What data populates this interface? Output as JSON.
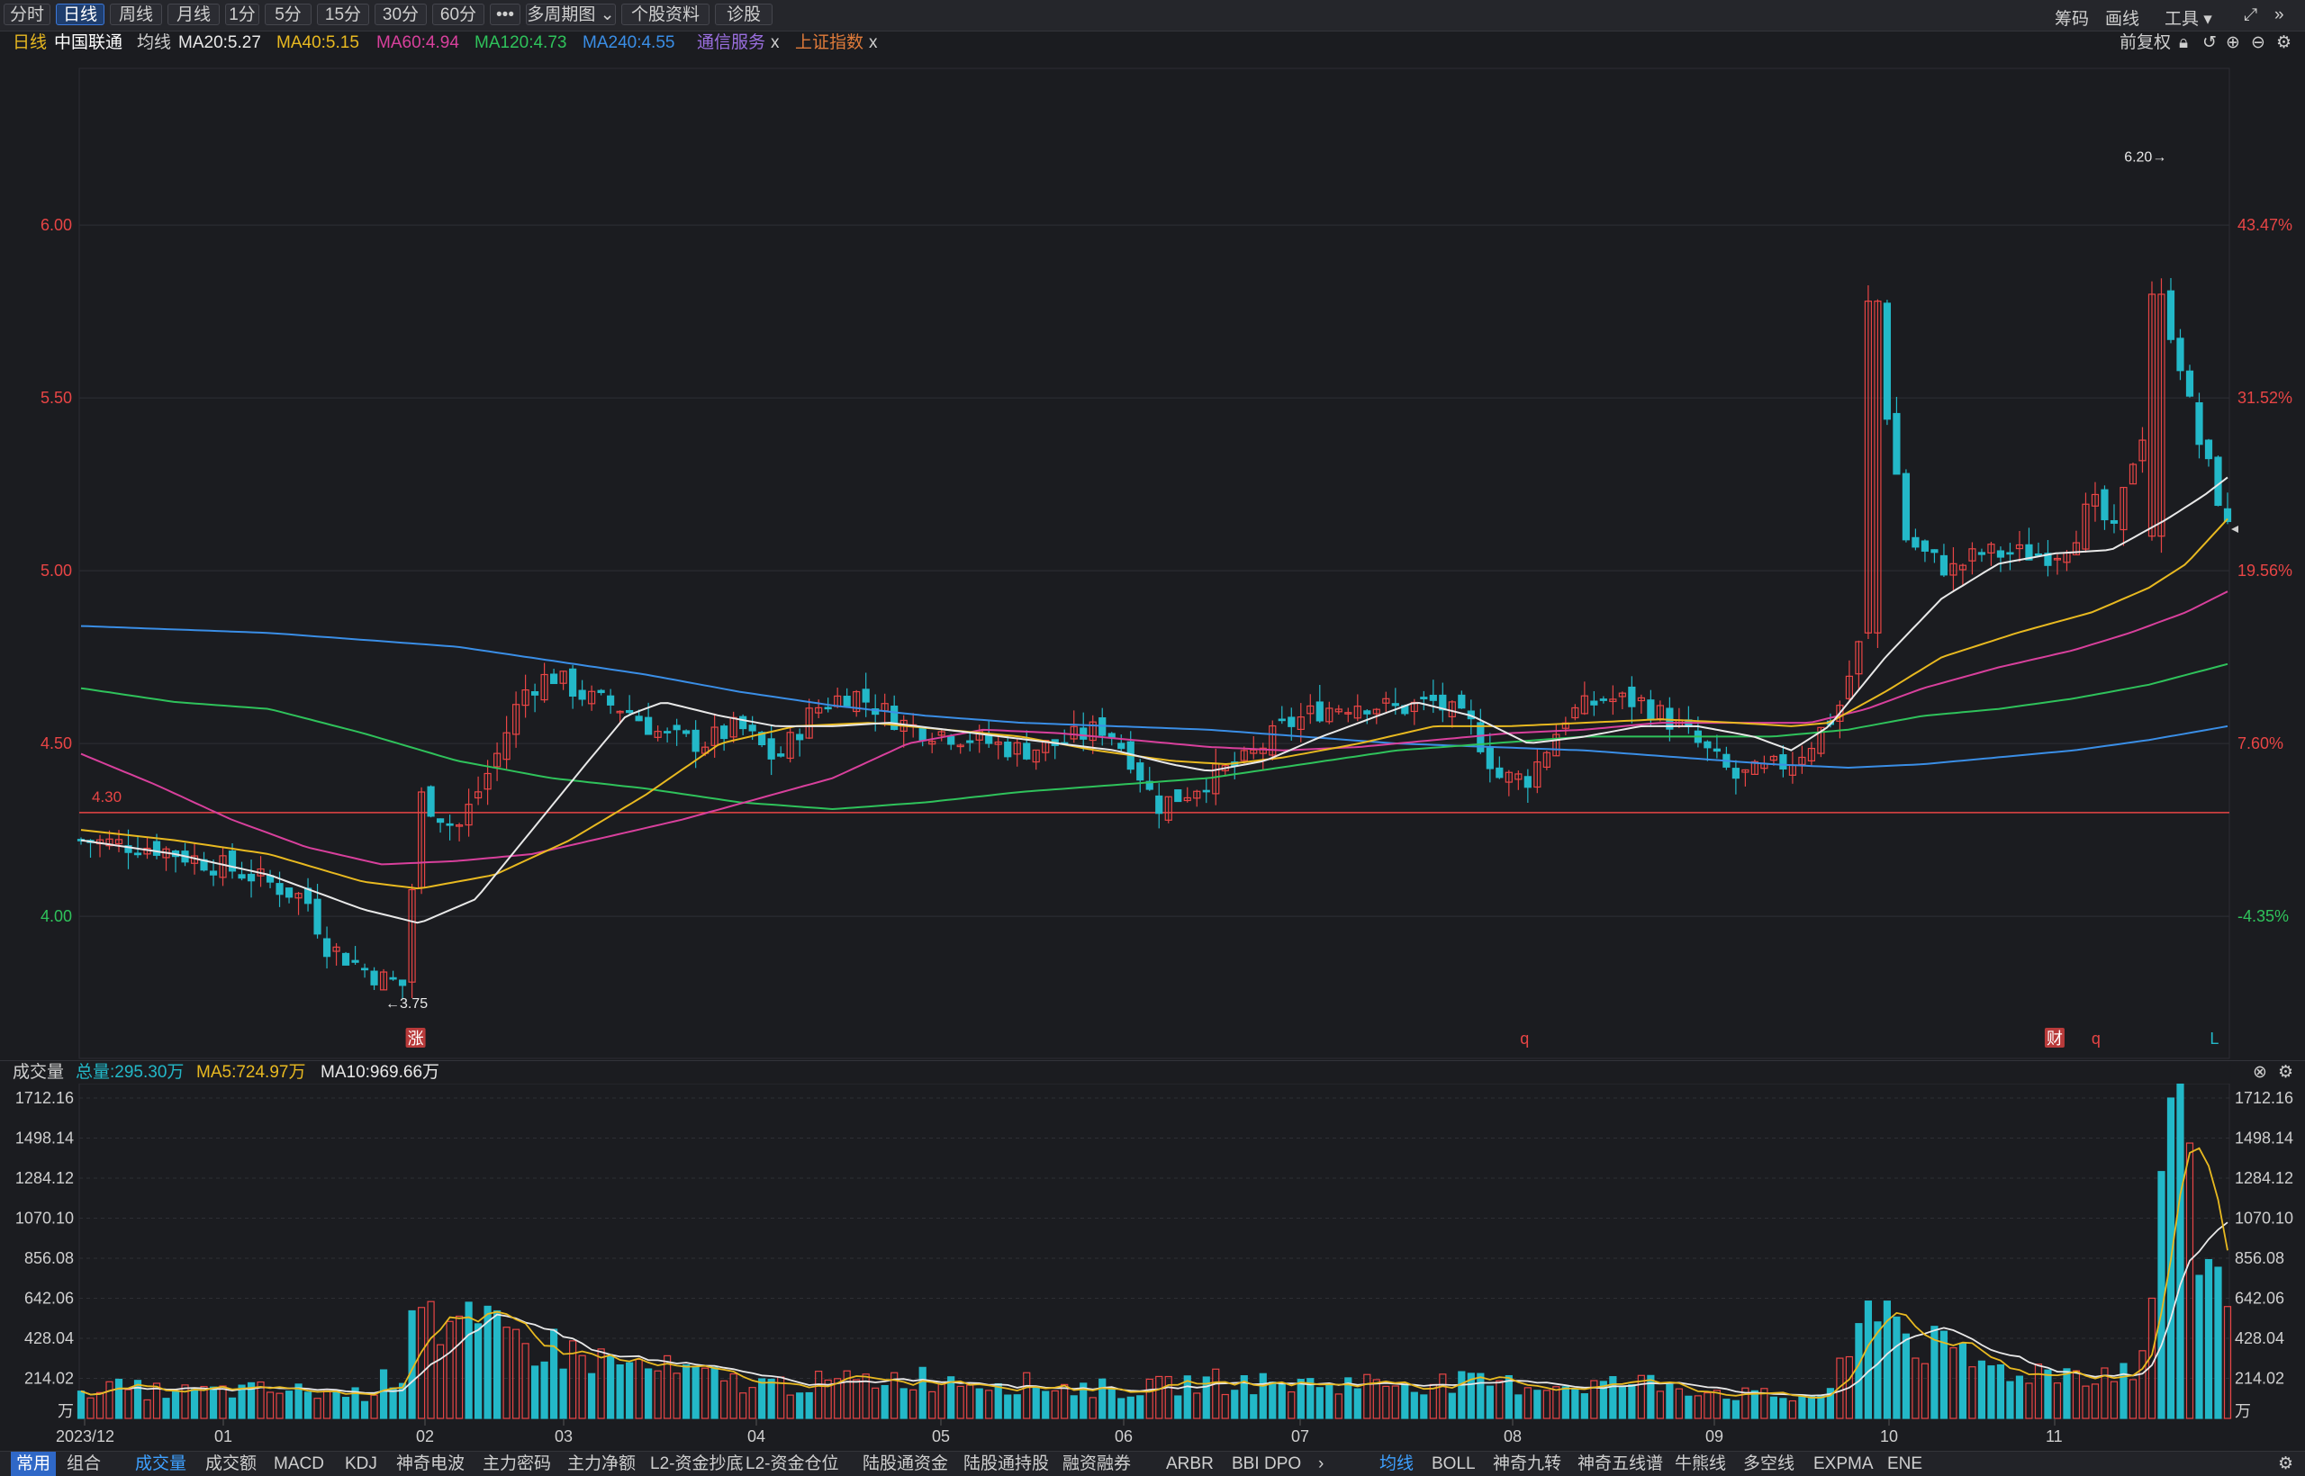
{
  "toolbar": {
    "buttons": [
      "分时",
      "日线",
      "周线",
      "月线",
      "1分",
      "5分",
      "15分",
      "30分",
      "60分",
      "•••",
      "多周期图",
      "个股资料",
      "诊股"
    ],
    "active": "日线",
    "right": [
      "筹码",
      "画线",
      "工具"
    ]
  },
  "legend": {
    "period": "日线",
    "stock": "中国联通",
    "ma_label": "均线",
    "ma20": "MA20:5.27",
    "ma40": "MA40:5.15",
    "ma60": "MA60:4.94",
    "ma120": "MA120:4.73",
    "ma240": "MA240:4.55",
    "sector": "通信服务",
    "index": "上证指数",
    "close_mark": "x",
    "adjust": "前复权"
  },
  "colors": {
    "up": "#e84545",
    "down": "#23b8c8",
    "ma20": "#e8e8e8",
    "ma40": "#e8b920",
    "ma60": "#d8409c",
    "ma120": "#2fc25b",
    "ma240": "#3a8ee6",
    "sector": "#9b6fe0",
    "index": "#e07b3a"
  },
  "price_axis": {
    "left_ticks": [
      "6.00",
      "5.50",
      "5.00",
      "4.50",
      "4.00"
    ],
    "left_values": [
      6.0,
      5.5,
      5.0,
      4.5,
      4.0
    ],
    "right_ticks": [
      "43.47%",
      "31.52%",
      "19.56%",
      "7.60%",
      "-4.35%"
    ],
    "ylim": [
      3.62,
      6.49
    ],
    "ref_line_value": 4.3,
    "ref_line_label": "4.30",
    "high_label": "6.20",
    "low_label": "3.75"
  },
  "markers": [
    {
      "text": "涨",
      "month_index": 1.78
    },
    {
      "text": "q",
      "month_index": 7.68
    },
    {
      "text": "财",
      "month_index": 10.5
    },
    {
      "text": "q",
      "month_index": 10.72
    },
    {
      "text": "L",
      "month_index": 11.35
    }
  ],
  "volume": {
    "title": "成交量",
    "total": "总量:295.30万",
    "ma5": "MA5:724.97万",
    "ma10": "MA10:969.66万",
    "ticks": [
      "1712.16",
      "1498.14",
      "1284.12",
      "1070.10",
      "856.08",
      "642.06",
      "428.04",
      "214.02"
    ],
    "tick_values": [
      1712.16,
      1498.14,
      1284.12,
      1070.1,
      856.08,
      642.06,
      428.04,
      214.02
    ],
    "unit": "万",
    "max": 1712.16
  },
  "x_axis": {
    "labels": [
      "2023/12",
      "01",
      "02",
      "03",
      "04",
      "05",
      "06",
      "07",
      "08",
      "09",
      "10",
      "11"
    ]
  },
  "bottom_tabs": {
    "left": [
      "常用",
      "组合"
    ],
    "indicators": [
      "成交量",
      "成交额",
      "MACD",
      "KDJ",
      "神奇电波",
      "主力密码",
      "主力净额",
      "L2-资金抄底",
      "L2-资金仓位",
      "陆股通资金",
      "陆股通持股",
      "融资融券",
      "ARBR",
      "BBI",
      "DPO"
    ],
    "overlays": [
      "均线",
      "BOLL",
      "神奇九转",
      "神奇五线谱",
      "牛熊线",
      "多空线",
      "EXPMA",
      "ENE"
    ]
  },
  "chart_data": {
    "type": "candlestick",
    "title": "",
    "xlabel": "",
    "ylabel": "",
    "x_categories": [
      "2023/12",
      "01",
      "02",
      "03",
      "04",
      "05",
      "06",
      "07",
      "08",
      "09",
      "10",
      "11"
    ],
    "anchor_closes": [
      [
        0.0,
        4.22
      ],
      [
        0.4,
        4.2
      ],
      [
        0.9,
        4.12
      ],
      [
        1.2,
        4.05
      ],
      [
        1.3,
        3.92
      ],
      [
        1.5,
        3.85
      ],
      [
        1.6,
        3.82
      ],
      [
        1.72,
        3.8
      ],
      [
        1.8,
        4.35
      ],
      [
        2.0,
        4.25
      ],
      [
        2.2,
        4.45
      ],
      [
        2.35,
        4.65
      ],
      [
        2.5,
        4.7
      ],
      [
        2.7,
        4.63
      ],
      [
        2.9,
        4.6
      ],
      [
        3.1,
        4.52
      ],
      [
        3.3,
        4.5
      ],
      [
        3.5,
        4.55
      ],
      [
        3.7,
        4.45
      ],
      [
        3.9,
        4.6
      ],
      [
        4.1,
        4.65
      ],
      [
        4.4,
        4.55
      ],
      [
        4.7,
        4.52
      ],
      [
        5.0,
        4.48
      ],
      [
        5.2,
        4.5
      ],
      [
        5.45,
        4.55
      ],
      [
        5.6,
        4.45
      ],
      [
        5.72,
        4.32
      ],
      [
        5.85,
        4.35
      ],
      [
        6.0,
        4.4
      ],
      [
        6.2,
        4.45
      ],
      [
        6.4,
        4.55
      ],
      [
        6.6,
        4.6
      ],
      [
        6.8,
        4.62
      ],
      [
        7.0,
        4.6
      ],
      [
        7.2,
        4.62
      ],
      [
        7.4,
        4.55
      ],
      [
        7.55,
        4.4
      ],
      [
        7.7,
        4.4
      ],
      [
        7.9,
        4.58
      ],
      [
        8.1,
        4.63
      ],
      [
        8.3,
        4.62
      ],
      [
        8.5,
        4.55
      ],
      [
        8.7,
        4.45
      ],
      [
        8.8,
        4.4
      ],
      [
        8.95,
        4.42
      ],
      [
        9.1,
        4.45
      ],
      [
        9.2,
        4.5
      ],
      [
        9.35,
        4.6
      ],
      [
        9.5,
        4.85
      ],
      [
        9.55,
        5.5
      ],
      [
        9.62,
        5.45
      ],
      [
        9.7,
        5.1
      ],
      [
        9.8,
        5.05
      ],
      [
        9.95,
        5.0
      ],
      [
        10.1,
        5.05
      ],
      [
        10.3,
        5.05
      ],
      [
        10.5,
        5.05
      ],
      [
        10.6,
        5.1
      ],
      [
        10.7,
        5.2
      ],
      [
        10.82,
        5.1
      ],
      [
        10.9,
        5.3
      ],
      [
        11.0,
        5.45
      ],
      [
        11.05,
        5.8
      ],
      [
        11.15,
        5.65
      ],
      [
        11.25,
        5.4
      ],
      [
        11.35,
        5.25
      ],
      [
        11.42,
        5.12
      ]
    ],
    "ma20_anchors": [
      [
        0,
        4.22
      ],
      [
        0.5,
        4.18
      ],
      [
        1.0,
        4.12
      ],
      [
        1.5,
        4.02
      ],
      [
        1.8,
        3.98
      ],
      [
        2.1,
        4.05
      ],
      [
        2.4,
        4.25
      ],
      [
        2.7,
        4.45
      ],
      [
        2.9,
        4.58
      ],
      [
        3.1,
        4.62
      ],
      [
        3.4,
        4.58
      ],
      [
        3.7,
        4.55
      ],
      [
        4.0,
        4.55
      ],
      [
        4.3,
        4.56
      ],
      [
        4.6,
        4.54
      ],
      [
        4.9,
        4.52
      ],
      [
        5.2,
        4.5
      ],
      [
        5.5,
        4.48
      ],
      [
        5.8,
        4.44
      ],
      [
        6.0,
        4.42
      ],
      [
        6.3,
        4.45
      ],
      [
        6.6,
        4.52
      ],
      [
        6.9,
        4.58
      ],
      [
        7.1,
        4.62
      ],
      [
        7.4,
        4.58
      ],
      [
        7.7,
        4.5
      ],
      [
        8.0,
        4.52
      ],
      [
        8.3,
        4.55
      ],
      [
        8.6,
        4.55
      ],
      [
        8.9,
        4.52
      ],
      [
        9.1,
        4.48
      ],
      [
        9.3,
        4.55
      ],
      [
        9.6,
        4.75
      ],
      [
        9.9,
        4.92
      ],
      [
        10.2,
        5.02
      ],
      [
        10.5,
        5.05
      ],
      [
        10.8,
        5.06
      ],
      [
        11.1,
        5.15
      ],
      [
        11.3,
        5.22
      ],
      [
        11.42,
        5.27
      ]
    ],
    "ma40_anchors": [
      [
        0,
        4.25
      ],
      [
        0.5,
        4.22
      ],
      [
        1.0,
        4.18
      ],
      [
        1.5,
        4.1
      ],
      [
        1.8,
        4.08
      ],
      [
        2.2,
        4.12
      ],
      [
        2.6,
        4.22
      ],
      [
        3.0,
        4.35
      ],
      [
        3.4,
        4.5
      ],
      [
        3.8,
        4.55
      ],
      [
        4.2,
        4.56
      ],
      [
        4.6,
        4.54
      ],
      [
        5.0,
        4.52
      ],
      [
        5.4,
        4.48
      ],
      [
        5.8,
        4.45
      ],
      [
        6.1,
        4.44
      ],
      [
        6.4,
        4.46
      ],
      [
        6.8,
        4.5
      ],
      [
        7.2,
        4.55
      ],
      [
        7.6,
        4.55
      ],
      [
        8.0,
        4.56
      ],
      [
        8.4,
        4.57
      ],
      [
        8.8,
        4.56
      ],
      [
        9.1,
        4.55
      ],
      [
        9.3,
        4.56
      ],
      [
        9.6,
        4.65
      ],
      [
        9.9,
        4.75
      ],
      [
        10.3,
        4.82
      ],
      [
        10.7,
        4.88
      ],
      [
        11.0,
        4.95
      ],
      [
        11.2,
        5.02
      ],
      [
        11.42,
        5.15
      ]
    ],
    "ma60_anchors": [
      [
        0,
        4.47
      ],
      [
        0.4,
        4.38
      ],
      [
        0.8,
        4.28
      ],
      [
        1.2,
        4.2
      ],
      [
        1.6,
        4.15
      ],
      [
        2.0,
        4.16
      ],
      [
        2.4,
        4.18
      ],
      [
        2.8,
        4.23
      ],
      [
        3.2,
        4.28
      ],
      [
        3.6,
        4.34
      ],
      [
        4.0,
        4.4
      ],
      [
        4.4,
        4.5
      ],
      [
        4.8,
        4.54
      ],
      [
        5.2,
        4.53
      ],
      [
        5.6,
        4.51
      ],
      [
        6.0,
        4.49
      ],
      [
        6.4,
        4.48
      ],
      [
        6.8,
        4.49
      ],
      [
        7.2,
        4.51
      ],
      [
        7.6,
        4.53
      ],
      [
        8.0,
        4.54
      ],
      [
        8.4,
        4.56
      ],
      [
        8.8,
        4.56
      ],
      [
        9.2,
        4.56
      ],
      [
        9.5,
        4.6
      ],
      [
        9.8,
        4.66
      ],
      [
        10.2,
        4.72
      ],
      [
        10.6,
        4.77
      ],
      [
        10.9,
        4.82
      ],
      [
        11.2,
        4.88
      ],
      [
        11.42,
        4.94
      ]
    ],
    "ma120_anchors": [
      [
        0,
        4.66
      ],
      [
        0.5,
        4.62
      ],
      [
        1.0,
        4.6
      ],
      [
        1.5,
        4.53
      ],
      [
        2.0,
        4.45
      ],
      [
        2.5,
        4.4
      ],
      [
        3.0,
        4.37
      ],
      [
        3.5,
        4.33
      ],
      [
        4.0,
        4.31
      ],
      [
        4.5,
        4.33
      ],
      [
        5.0,
        4.36
      ],
      [
        5.5,
        4.38
      ],
      [
        6.0,
        4.4
      ],
      [
        6.5,
        4.44
      ],
      [
        7.0,
        4.48
      ],
      [
        7.5,
        4.5
      ],
      [
        8.0,
        4.52
      ],
      [
        8.5,
        4.52
      ],
      [
        9.0,
        4.52
      ],
      [
        9.4,
        4.54
      ],
      [
        9.8,
        4.58
      ],
      [
        10.2,
        4.6
      ],
      [
        10.6,
        4.63
      ],
      [
        11.0,
        4.67
      ],
      [
        11.42,
        4.73
      ]
    ],
    "ma240_anchors": [
      [
        0,
        4.84
      ],
      [
        0.5,
        4.83
      ],
      [
        1.0,
        4.82
      ],
      [
        1.5,
        4.8
      ],
      [
        2.0,
        4.78
      ],
      [
        2.5,
        4.74
      ],
      [
        3.0,
        4.7
      ],
      [
        3.5,
        4.65
      ],
      [
        4.0,
        4.61
      ],
      [
        4.5,
        4.58
      ],
      [
        5.0,
        4.56
      ],
      [
        5.5,
        4.55
      ],
      [
        6.0,
        4.54
      ],
      [
        6.5,
        4.52
      ],
      [
        7.0,
        4.5
      ],
      [
        7.5,
        4.49
      ],
      [
        8.0,
        4.48
      ],
      [
        8.5,
        4.46
      ],
      [
        9.0,
        4.44
      ],
      [
        9.4,
        4.43
      ],
      [
        9.8,
        4.44
      ],
      [
        10.2,
        4.46
      ],
      [
        10.6,
        4.48
      ],
      [
        11.0,
        4.51
      ],
      [
        11.42,
        4.55
      ]
    ],
    "volume_anchors": [
      [
        0,
        170
      ],
      [
        0.5,
        140
      ],
      [
        1.0,
        150
      ],
      [
        1.5,
        130
      ],
      [
        1.72,
        260
      ],
      [
        1.78,
        850
      ],
      [
        1.9,
        500
      ],
      [
        2.2,
        440
      ],
      [
        2.5,
        380
      ],
      [
        2.8,
        300
      ],
      [
        3.2,
        240
      ],
      [
        3.6,
        180
      ],
      [
        4.0,
        190
      ],
      [
        4.4,
        220
      ],
      [
        4.8,
        200
      ],
      [
        5.2,
        170
      ],
      [
        5.6,
        150
      ],
      [
        6.0,
        200
      ],
      [
        6.4,
        180
      ],
      [
        6.8,
        190
      ],
      [
        7.2,
        190
      ],
      [
        7.6,
        180
      ],
      [
        8.0,
        180
      ],
      [
        8.4,
        190
      ],
      [
        8.8,
        130
      ],
      [
        9.1,
        110
      ],
      [
        9.3,
        140
      ],
      [
        9.45,
        400
      ],
      [
        9.55,
        720
      ],
      [
        9.7,
        460
      ],
      [
        9.9,
        350
      ],
      [
        10.2,
        260
      ],
      [
        10.5,
        250
      ],
      [
        10.8,
        250
      ],
      [
        11.0,
        300
      ],
      [
        11.05,
        1290
      ],
      [
        11.12,
        1712
      ],
      [
        11.2,
        1280
      ],
      [
        11.3,
        900
      ],
      [
        11.42,
        620
      ]
    ]
  }
}
